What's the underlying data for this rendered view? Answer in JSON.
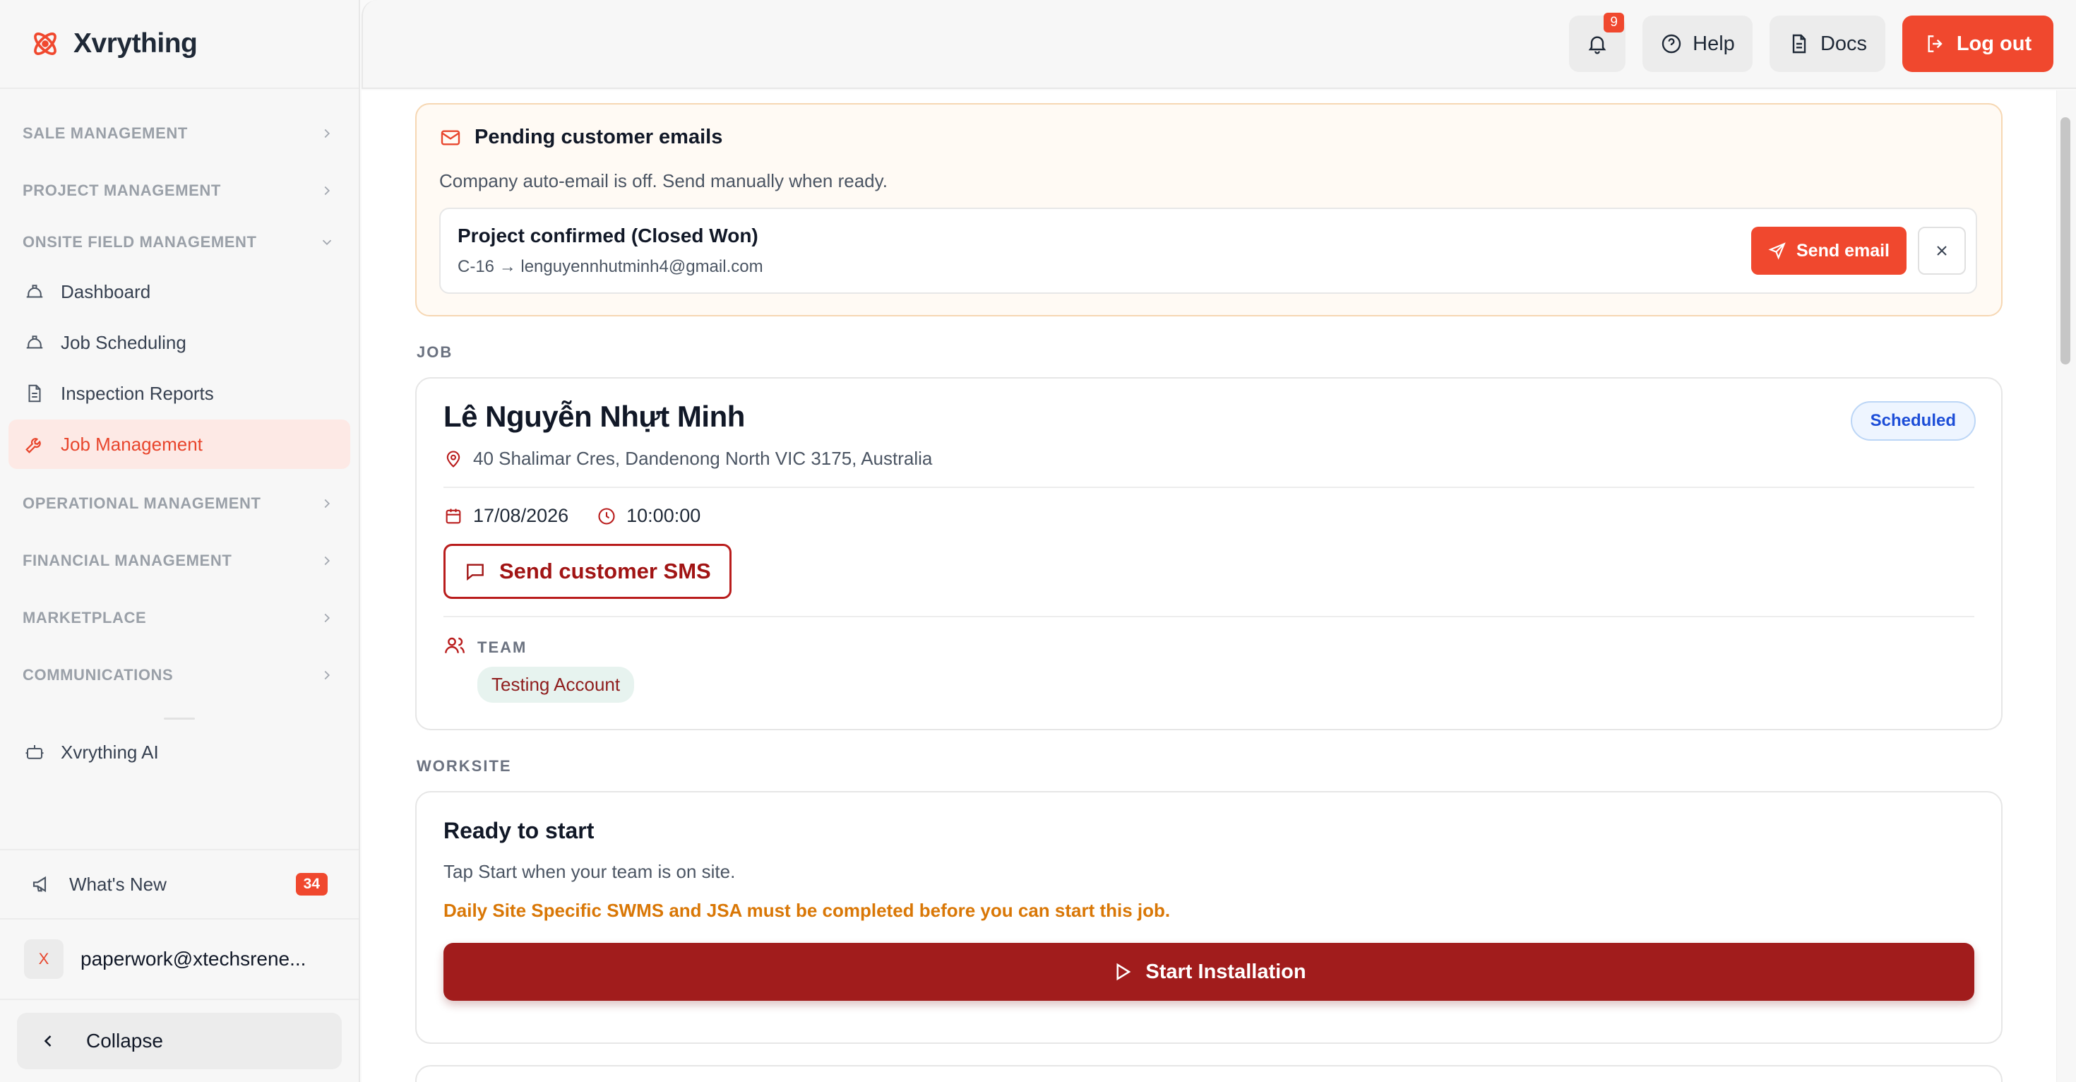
{
  "brand": {
    "name": "Xvrything",
    "accent": "#f0482e"
  },
  "sidebar": {
    "sections": [
      {
        "label": "SALE MANAGEMENT"
      },
      {
        "label": "PROJECT MANAGEMENT"
      },
      {
        "label": "ONSITE FIELD MANAGEMENT",
        "expanded": true
      }
    ],
    "onsite_items": [
      {
        "label": "Dashboard",
        "icon": "hard-hat-icon"
      },
      {
        "label": "Job Scheduling",
        "icon": "hard-hat-icon"
      },
      {
        "label": "Inspection Reports",
        "icon": "file-text-icon"
      },
      {
        "label": "Job Management",
        "icon": "wrench-icon",
        "active": true
      }
    ],
    "sections_after": [
      {
        "label": "OPERATIONAL MANAGEMENT"
      },
      {
        "label": "FINANCIAL MANAGEMENT"
      },
      {
        "label": "MARKETPLACE"
      },
      {
        "label": "COMMUNICATIONS"
      }
    ],
    "ai_item": {
      "label": "Xvrything AI",
      "icon": "bot-icon"
    },
    "whats_new": {
      "label": "What's New",
      "count": "34"
    },
    "user": {
      "initial": "X",
      "email": "paperwork@xtechsrene..."
    },
    "collapse_label": "Collapse"
  },
  "topbar": {
    "notifications_count": "9",
    "help_label": "Help",
    "docs_label": "Docs",
    "logout_label": "Log out"
  },
  "pending_emails": {
    "title": "Pending customer emails",
    "subtitle": "Company auto-email is off. Send manually when ready.",
    "item": {
      "title": "Project confirmed (Closed Won)",
      "meta": "C-16 → lenguyennhutminh4@gmail.com",
      "send_label": "Send email"
    }
  },
  "job": {
    "section_label": "JOB",
    "customer_name": "Lê Nguyễn Nhựt Minh",
    "address": "40 Shalimar Cres, Dandenong North VIC 3175, Australia",
    "status": "Scheduled",
    "date": "17/08/2026",
    "time": "10:00:00",
    "sms_label": "Send customer SMS",
    "team_label": "TEAM",
    "team_member": "Testing Account"
  },
  "worksite": {
    "section_label": "WORKSITE",
    "title": "Ready to start",
    "subtitle": "Tap Start when your team is on site.",
    "warning": "Daily Site Specific SWMS and JSA must be completed before you can start this job.",
    "start_label": "Start Installation"
  }
}
